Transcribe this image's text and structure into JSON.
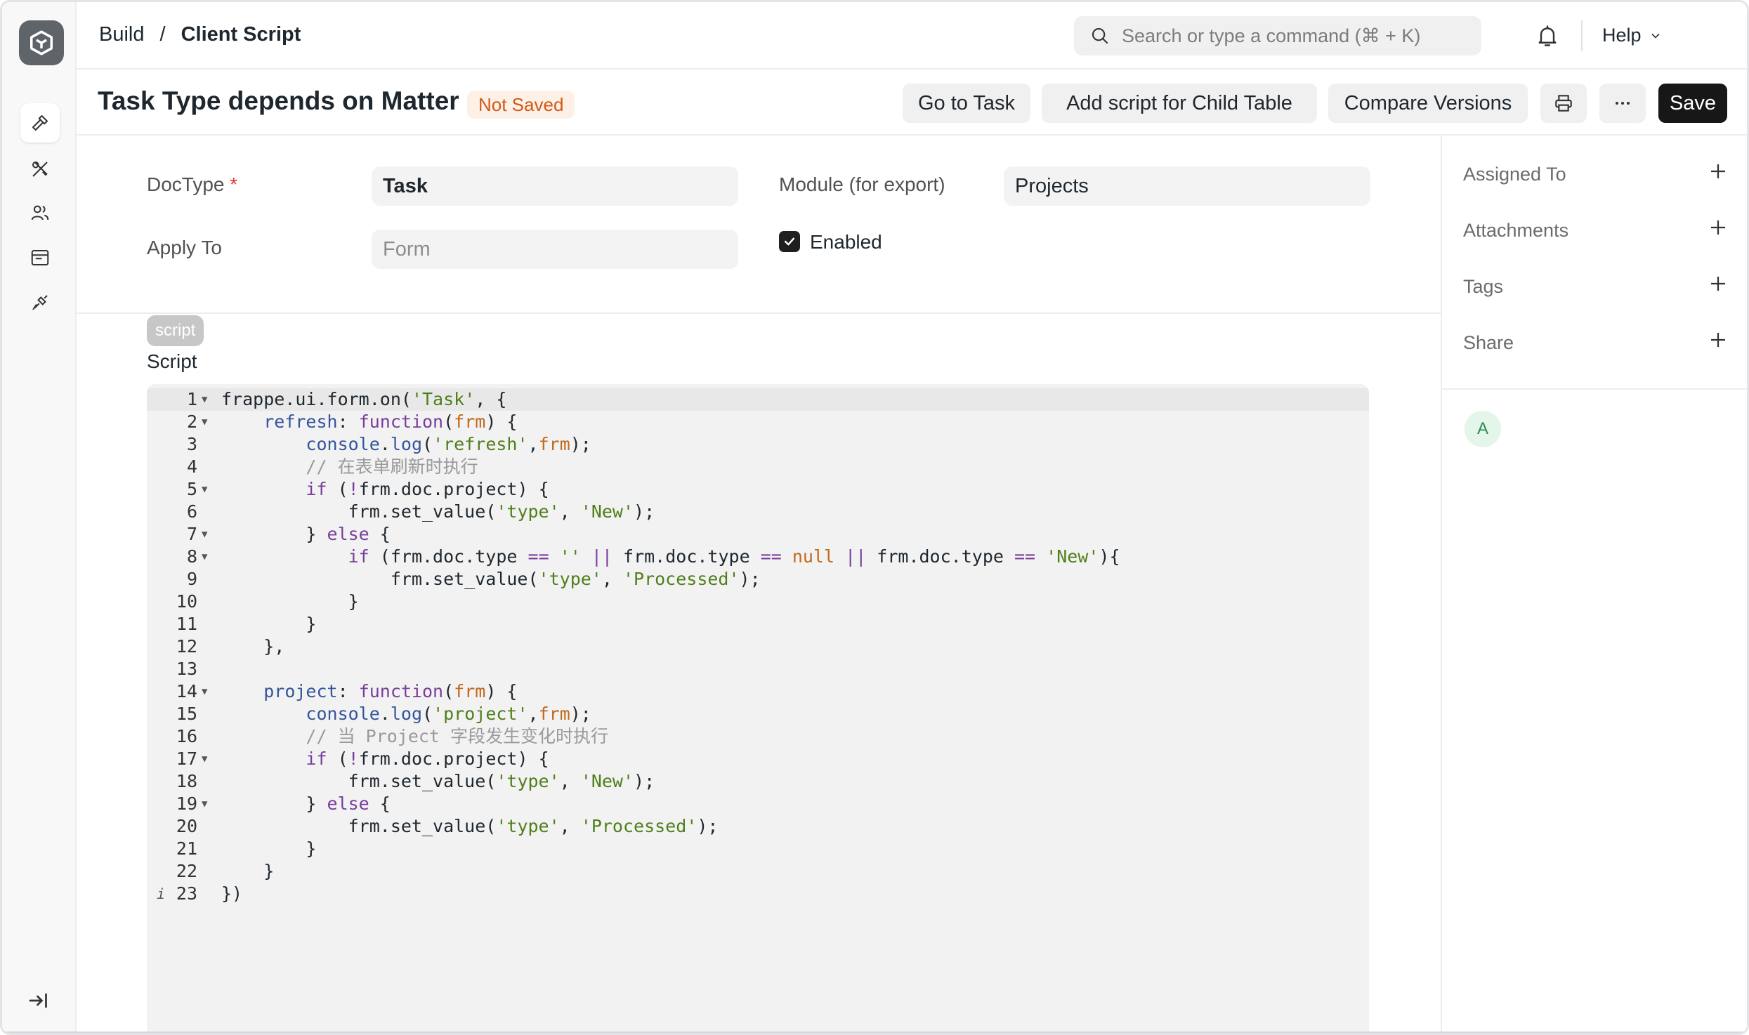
{
  "breadcrumb": {
    "parent": "Build",
    "separator": "/",
    "current": "Client Script"
  },
  "search": {
    "placeholder": "Search or type a command (⌘ + K)"
  },
  "help": {
    "label": "Help"
  },
  "user": {
    "initial": "A"
  },
  "header": {
    "title": "Task Type depends on Matter",
    "status": "Not Saved",
    "buttons": {
      "go_to": "Go to Task",
      "add_child": "Add script for Child Table",
      "compare": "Compare Versions",
      "save": "Save"
    }
  },
  "form": {
    "doctype": {
      "label": "DocType",
      "required_mark": "*",
      "value": "Task"
    },
    "module": {
      "label": "Module (for export)",
      "value": "Projects"
    },
    "apply_to": {
      "label": "Apply To",
      "placeholder": "Form"
    },
    "enabled": {
      "label": "Enabled",
      "checked": true
    },
    "script_tag": "script",
    "script_label": "Script"
  },
  "code_lines": [
    {
      "n": "1",
      "fold": true,
      "text": "frappe.ui.form.on('Task', {"
    },
    {
      "n": "2",
      "fold": true,
      "text": "    refresh: function(frm) {"
    },
    {
      "n": "3",
      "fold": false,
      "text": "        console.log('refresh',frm);"
    },
    {
      "n": "4",
      "fold": false,
      "text": "        // 在表单刷新时执行"
    },
    {
      "n": "5",
      "fold": true,
      "text": "        if (!frm.doc.project) {"
    },
    {
      "n": "6",
      "fold": false,
      "text": "            frm.set_value('type', 'New');"
    },
    {
      "n": "7",
      "fold": true,
      "text": "        } else {"
    },
    {
      "n": "8",
      "fold": true,
      "text": "            if (frm.doc.type == '' || frm.doc.type == null || frm.doc.type == 'New'){"
    },
    {
      "n": "9",
      "fold": false,
      "text": "                frm.set_value('type', 'Processed');"
    },
    {
      "n": "10",
      "fold": false,
      "text": "            }"
    },
    {
      "n": "11",
      "fold": false,
      "text": "        }"
    },
    {
      "n": "12",
      "fold": false,
      "text": "    },"
    },
    {
      "n": "13",
      "fold": false,
      "text": ""
    },
    {
      "n": "14",
      "fold": true,
      "text": "    project: function(frm) {"
    },
    {
      "n": "15",
      "fold": false,
      "text": "        console.log('project',frm);"
    },
    {
      "n": "16",
      "fold": false,
      "text": "        // 当 Project 字段发生变化时执行"
    },
    {
      "n": "17",
      "fold": true,
      "text": "        if (!frm.doc.project) {"
    },
    {
      "n": "18",
      "fold": false,
      "text": "            frm.set_value('type', 'New');"
    },
    {
      "n": "19",
      "fold": true,
      "text": "        } else {"
    },
    {
      "n": "20",
      "fold": false,
      "text": "            frm.set_value('type', 'Processed');"
    },
    {
      "n": "21",
      "fold": false,
      "text": "        }"
    },
    {
      "n": "22",
      "fold": false,
      "text": "    }"
    },
    {
      "n": "23",
      "fold": false,
      "info": true,
      "text": "})"
    }
  ],
  "sidebar_right": {
    "items": [
      {
        "label": "Assigned To"
      },
      {
        "label": "Attachments"
      },
      {
        "label": "Tags"
      },
      {
        "label": "Share"
      }
    ],
    "viewer_initial": "A"
  },
  "sidebar_left": {
    "icons": [
      "build-icon",
      "tools-icon",
      "users-icon",
      "browser-icon",
      "integrations-icon"
    ]
  }
}
